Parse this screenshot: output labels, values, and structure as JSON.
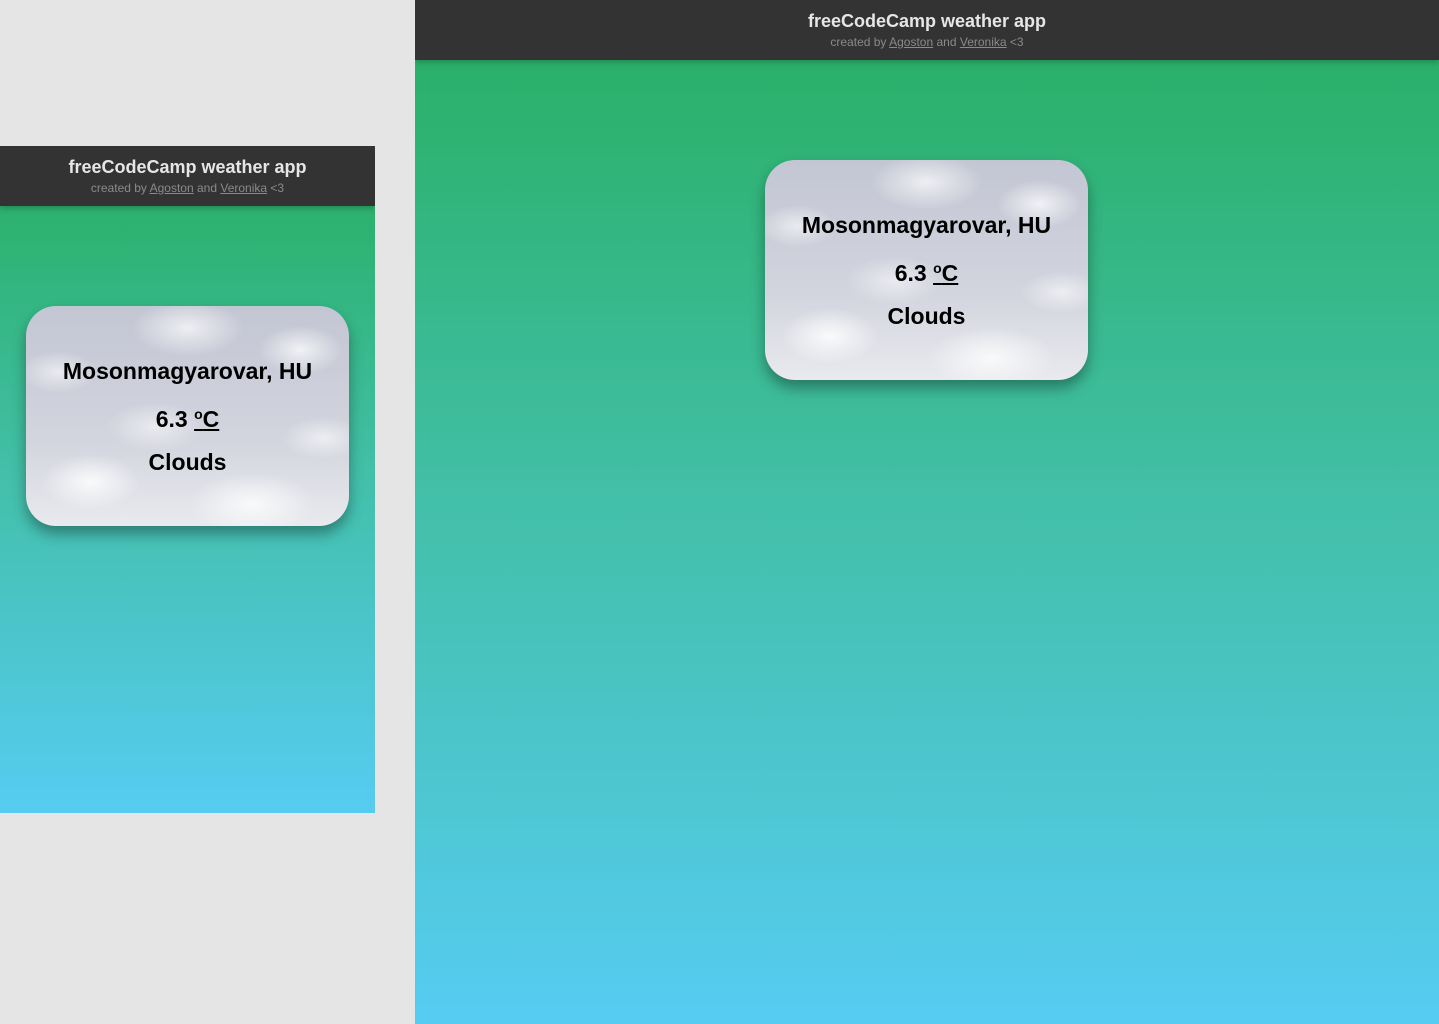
{
  "header": {
    "title": "freeCodeCamp weather app",
    "credits_prefix": "created by",
    "author1": "Agoston",
    "conjunction": "and",
    "author2": "Veronika",
    "credits_suffix": "<3"
  },
  "weather": {
    "location": "Mosonmagyarovar, HU",
    "temperature": "6.3",
    "unit_degree": "o",
    "unit_letter": "C",
    "condition": "Clouds"
  },
  "colors": {
    "header_bg": "#333333",
    "gradient_top": "#27ae60",
    "gradient_bottom": "#56ccf2",
    "outer_bg": "#e5e5e5"
  }
}
